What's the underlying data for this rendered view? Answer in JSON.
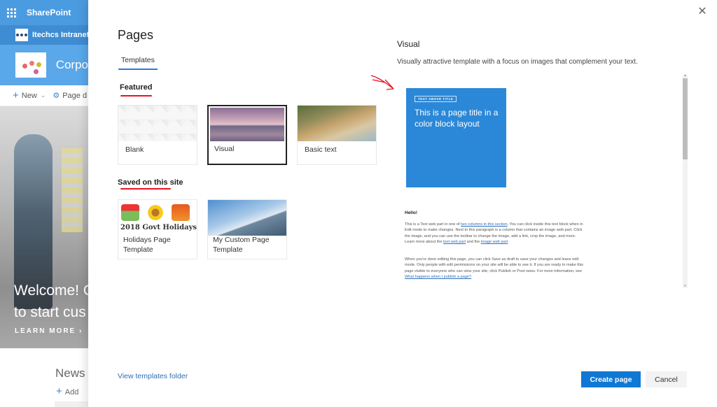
{
  "background_site": {
    "suite_title": "SharePoint",
    "hub_title": "Itechcs Intranet",
    "site_title": "Corpo",
    "command_bar": {
      "new_label": "New",
      "page_details_label": "Page d"
    },
    "hero": {
      "line1": "Welcome! C",
      "line2": "to start cus",
      "learn_more": "LEARN MORE"
    },
    "news": {
      "title": "News",
      "add_label": "Add"
    }
  },
  "panel": {
    "title": "Pages",
    "tabs": [
      {
        "label": "Templates",
        "active": true
      }
    ],
    "sections": [
      {
        "title": "Featured",
        "templates": [
          {
            "label": "Blank",
            "selected": false
          },
          {
            "label": "Visual",
            "selected": true
          },
          {
            "label": "Basic text",
            "selected": false
          }
        ]
      },
      {
        "title": "Saved on this site",
        "templates": [
          {
            "label": "Holidays Page Template",
            "thumb_text": "2018 Govt Holidays",
            "selected": false
          },
          {
            "label": "My Custom Page Template",
            "selected": false
          }
        ]
      }
    ],
    "view_templates_folder": "View templates folder",
    "preview": {
      "title": "Visual",
      "description": "Visually attractive template with a focus on images that complement your text.",
      "tag_text": "TEXT ABOVE TITLE",
      "block_title": "This is a page title in a color block layout",
      "hello": "Hello!",
      "para1": {
        "t1": "This is a Text web part in one of ",
        "link1": "two columns in this section",
        "t2": ". You can click inside this text block when in Edit mode to make changes. Next to this paragraph is a column that contains an image web part. Click the image, and you can use the toolbar to change the image, add a link, crop the image, and more. Learn more about the ",
        "link2": "text web part",
        "t3": " and the ",
        "link3": "image web part",
        "t4": "."
      },
      "para2": {
        "t1": "When you're done editing this page, you can click Save as draft to save your changes and leave edit mode. Only people with edit permissions on your site will be able to see it. If you are ready to make this page visible to everyone who can view your site, click Publish or Post news. For more information, see ",
        "link1": "What happens when I publish a page?"
      }
    },
    "buttons": {
      "create": "Create page",
      "cancel": "Cancel"
    },
    "colors": {
      "accent": "#0f78d4",
      "annotation_red": "#e81123",
      "preview_block": "#2b88d8"
    }
  }
}
